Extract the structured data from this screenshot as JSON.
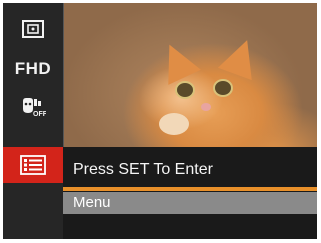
{
  "sidebar": {
    "items": [
      {
        "icon": "metering-icon"
      },
      {
        "label": "FHD",
        "icon": "video-quality-icon"
      },
      {
        "icon": "face-detection-off-icon"
      },
      {
        "icon": "menu-list-icon",
        "selected": true
      }
    ]
  },
  "panel": {
    "title": "Press SET To Enter",
    "item_label": "Menu"
  },
  "colors": {
    "accent_red": "#d3241a",
    "accent_orange": "#e8902a",
    "panel_bg": "#1a1a1a",
    "sidebar_bg": "#262626"
  }
}
